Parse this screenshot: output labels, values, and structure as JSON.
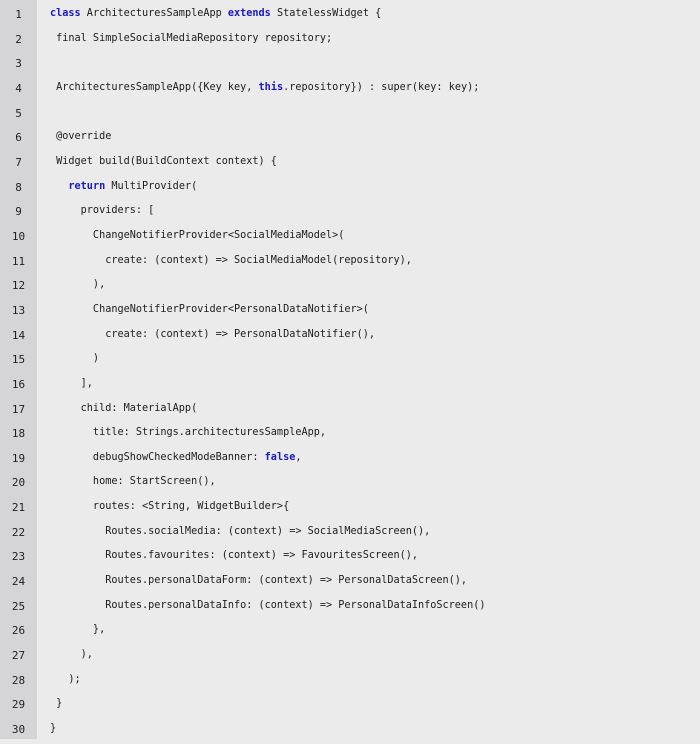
{
  "editor": {
    "colors": {
      "background": "#ebebeb",
      "gutter": "#d5d5d7",
      "keyword": "#1818c8",
      "text": "#1c1c1c"
    },
    "lines": [
      {
        "n": "1",
        "tokens": [
          {
            "t": "class",
            "k": 1
          },
          {
            "t": " ArchitecturesSampleApp "
          },
          {
            "t": "extends",
            "k": 1
          },
          {
            "t": " StatelessWidget {"
          }
        ]
      },
      {
        "n": "2",
        "tokens": [
          {
            "t": " final SimpleSocialMediaRepository repository;"
          }
        ]
      },
      {
        "n": "3",
        "tokens": []
      },
      {
        "n": "4",
        "tokens": [
          {
            "t": " ArchitecturesSampleApp({Key key, "
          },
          {
            "t": "this",
            "k": 1
          },
          {
            "t": ".repository}) : super(key: key);"
          }
        ]
      },
      {
        "n": "5",
        "tokens": []
      },
      {
        "n": "6",
        "tokens": [
          {
            "t": " @override"
          }
        ]
      },
      {
        "n": "7",
        "tokens": [
          {
            "t": " Widget build(BuildContext context) {"
          }
        ]
      },
      {
        "n": "8",
        "tokens": [
          {
            "t": "   "
          },
          {
            "t": "return",
            "k": 1
          },
          {
            "t": " MultiProvider("
          }
        ]
      },
      {
        "n": "9",
        "tokens": [
          {
            "t": "     providers: ["
          }
        ]
      },
      {
        "n": "10",
        "tokens": [
          {
            "t": "       ChangeNotifierProvider<SocialMediaModel>("
          }
        ]
      },
      {
        "n": "11",
        "tokens": [
          {
            "t": "         create: (context) => SocialMediaModel(repository),"
          }
        ]
      },
      {
        "n": "12",
        "tokens": [
          {
            "t": "       ),"
          }
        ]
      },
      {
        "n": "13",
        "tokens": [
          {
            "t": "       ChangeNotifierProvider<PersonalDataNotifier>("
          }
        ]
      },
      {
        "n": "14",
        "tokens": [
          {
            "t": "         create: (context) => PersonalDataNotifier(),"
          }
        ]
      },
      {
        "n": "15",
        "tokens": [
          {
            "t": "       )"
          }
        ]
      },
      {
        "n": "16",
        "tokens": [
          {
            "t": "     ],"
          }
        ]
      },
      {
        "n": "17",
        "tokens": [
          {
            "t": "     child: MaterialApp("
          }
        ]
      },
      {
        "n": "18",
        "tokens": [
          {
            "t": "       title: Strings.architecturesSampleApp,"
          }
        ]
      },
      {
        "n": "19",
        "tokens": [
          {
            "t": "       debugShowCheckedModeBanner: "
          },
          {
            "t": "false",
            "k": 1
          },
          {
            "t": ","
          }
        ]
      },
      {
        "n": "20",
        "tokens": [
          {
            "t": "       home: StartScreen(),"
          }
        ]
      },
      {
        "n": "21",
        "tokens": [
          {
            "t": "       routes: <String, WidgetBuilder>{"
          }
        ]
      },
      {
        "n": "22",
        "tokens": [
          {
            "t": "         Routes.socialMedia: (context) => SocialMediaScreen(),"
          }
        ]
      },
      {
        "n": "23",
        "tokens": [
          {
            "t": "         Routes.favourites: (context) => FavouritesScreen(),"
          }
        ]
      },
      {
        "n": "24",
        "tokens": [
          {
            "t": "         Routes.personalDataForm: (context) => PersonalDataScreen(),"
          }
        ]
      },
      {
        "n": "25",
        "tokens": [
          {
            "t": "         Routes.personalDataInfo: (context) => PersonalDataInfoScreen()"
          }
        ]
      },
      {
        "n": "26",
        "tokens": [
          {
            "t": "       },"
          }
        ]
      },
      {
        "n": "27",
        "tokens": [
          {
            "t": "     ),"
          }
        ]
      },
      {
        "n": "28",
        "tokens": [
          {
            "t": "   );"
          }
        ]
      },
      {
        "n": "29",
        "tokens": [
          {
            "t": " }"
          }
        ]
      },
      {
        "n": "30",
        "tokens": [
          {
            "t": "}"
          }
        ]
      }
    ]
  }
}
